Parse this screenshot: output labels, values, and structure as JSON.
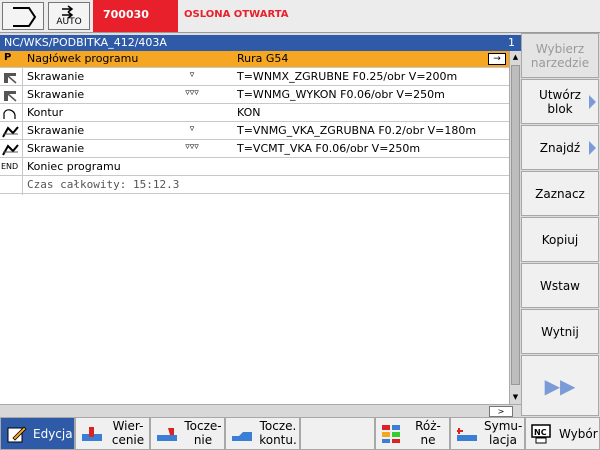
{
  "topbar": {
    "mode_label": "AUTO",
    "alarm_number": "700030",
    "alarm_text": "OSLONA OTWARTA"
  },
  "header": {
    "path": "NC/WKS/PODBITKA_412/403A",
    "page_number": "1"
  },
  "program_rows": [
    {
      "icon": "header-icon",
      "icon_text": "P",
      "name": "Nagłówek programu",
      "marks": "",
      "value": "Rura G54",
      "selected": true
    },
    {
      "icon": "cutting-icon",
      "icon_text": "",
      "name": "Skrawanie",
      "marks": "▿",
      "value": "T=WNMX_ZGRUBNE F0.25/obr V=200m",
      "selected": false
    },
    {
      "icon": "cutting-icon",
      "icon_text": "",
      "name": "Skrawanie",
      "marks": "▿▿▿",
      "value": "T=WNMG_WYKON F0.06/obr V=250m",
      "selected": false
    },
    {
      "icon": "contour-icon",
      "icon_text": "",
      "name": "Kontur",
      "marks": "",
      "value": "KON",
      "selected": false
    },
    {
      "icon": "contour-cut-icon",
      "icon_text": "",
      "name": "Skrawanie",
      "marks": "▿",
      "value": "T=VNMG_VKA_ZGRUBNA F0.2/obr V=180m",
      "selected": false
    },
    {
      "icon": "contour-cut-icon",
      "icon_text": "",
      "name": "Skrawanie",
      "marks": "▿▿▿",
      "value": "T=VCMT_VKA F0.06/obr V=250m",
      "selected": false
    },
    {
      "icon": "end-icon",
      "icon_text": "END",
      "name": "Koniec programu",
      "marks": "",
      "value": "",
      "selected": false
    }
  ],
  "total_time": "Czas całkowity:  15:12.3",
  "right_softkeys": [
    {
      "label": "Wybierz narzedzie",
      "enabled": false,
      "arrow": false
    },
    {
      "label": "Utwórz blok",
      "enabled": true,
      "arrow": true
    },
    {
      "label": "Znajdź",
      "enabled": true,
      "arrow": true
    },
    {
      "label": "Zaznacz",
      "enabled": true,
      "arrow": false
    },
    {
      "label": "Kopiuj",
      "enabled": true,
      "arrow": false
    },
    {
      "label": "Wstaw",
      "enabled": true,
      "arrow": false
    },
    {
      "label": "Wytnij",
      "enabled": true,
      "arrow": false
    },
    {
      "label": "▶▶",
      "enabled": true,
      "arrow": false
    }
  ],
  "bottom_softkeys": [
    {
      "line1": "Edycja",
      "line2": "",
      "active": true
    },
    {
      "line1": "Wier-",
      "line2": "cenie",
      "active": false
    },
    {
      "line1": "Tocze-",
      "line2": "nie",
      "active": false
    },
    {
      "line1": "Tocze.",
      "line2": "kontu.",
      "active": false
    },
    {
      "line1": "",
      "line2": "",
      "active": false
    },
    {
      "line1": "Róż-",
      "line2": "ne",
      "active": false
    },
    {
      "line1": "Symu-",
      "line2": "lacja",
      "active": false
    },
    {
      "line1": "Wybór",
      "line2": "",
      "active": false
    }
  ],
  "colors": {
    "accent_blue": "#2e5aa8",
    "selection_orange": "#f5a623",
    "alarm_red": "#e8202c"
  }
}
